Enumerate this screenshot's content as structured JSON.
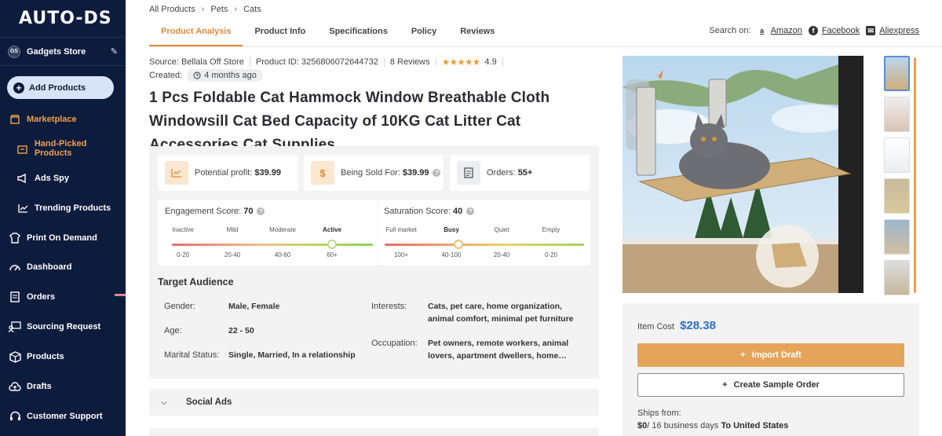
{
  "logo": "AUTO-DS",
  "store": {
    "badge": "GS",
    "name": "Gadgets Store"
  },
  "sidebar": {
    "add_products": "Add Products",
    "items": [
      {
        "label": "Marketplace"
      },
      {
        "label": "Hand-Picked Products"
      },
      {
        "label": "Ads Spy"
      },
      {
        "label": "Trending Products"
      },
      {
        "label": "Print On Demand"
      },
      {
        "label": "Dashboard"
      },
      {
        "label": "Orders"
      },
      {
        "label": "Sourcing Request"
      },
      {
        "label": "Products"
      },
      {
        "label": "Drafts"
      },
      {
        "label": "Customer Support"
      }
    ]
  },
  "breadcrumb": [
    "All Products",
    "Pets",
    "Cats"
  ],
  "tabs": [
    "Product Analysis",
    "Product Info",
    "Specifications",
    "Policy",
    "Reviews"
  ],
  "search_on": {
    "label": "Search on:",
    "links": [
      "Amazon",
      "Facebook",
      "Aliexpress"
    ]
  },
  "meta": {
    "source": "Source: Bellala Off Store",
    "product_id": "Product ID: 3256806072644732",
    "reviews": "8 Reviews",
    "rating": "4.9",
    "created_label": "Created:",
    "created_value": "4 months ago"
  },
  "title": "1 Pcs Foldable Cat Hammock Window Breathable Cloth Windowsill Cat Bed Capacity of 10KG Cat Litter Cat Accessories Cat Supplies",
  "stats": {
    "profit_label": "Potential profit:",
    "profit_value": "$39.99",
    "sold_label": "Being Sold For:",
    "sold_value": "$39.99",
    "orders_label": "Orders:",
    "orders_value": "55+"
  },
  "engagement": {
    "label": "Engagement Score:",
    "value": "70",
    "levels": [
      "Inactive",
      "Mild",
      "Moderate",
      "Active"
    ],
    "ranges": [
      "0-20",
      "20-40",
      "40-60",
      "60+"
    ],
    "score": 70
  },
  "saturation": {
    "label": "Saturation Score:",
    "value": "40",
    "levels": [
      "Full market",
      "Busy",
      "Quiet",
      "Empty"
    ],
    "ranges": [
      "100+",
      "40-100",
      "20-40",
      "0-20"
    ],
    "score": 40
  },
  "audience": {
    "title": "Target Audience",
    "gender_label": "Gender:",
    "gender_value": "Male, Female",
    "age_label": "Age:",
    "age_value": "22 - 50",
    "marital_label": "Marital Status:",
    "marital_value": "Single, Married, In a relationship",
    "interests_label": "Interests:",
    "interests_value": "Cats, pet care, home organization, animal comfort, minimal pet furniture",
    "occupation_label": "Occupation:",
    "occupation_value": "Pet owners, remote workers, animal lovers, apartment dwellers, home…"
  },
  "social_ads": "Social Ads",
  "buy": {
    "cost_label": "Item Cost",
    "cost_value": "$28.38",
    "import": "Import Draft",
    "sample": "Create Sample Order",
    "ships_label": "Ships from:",
    "ships_price": "$0",
    "ships_days": "/ 16 business days",
    "ships_to": "To United States"
  },
  "colors": {
    "sidebar": "#0d1c3d",
    "accent": "#e08a3b",
    "price": "#2a6fd0",
    "import": "#e4a55a"
  }
}
